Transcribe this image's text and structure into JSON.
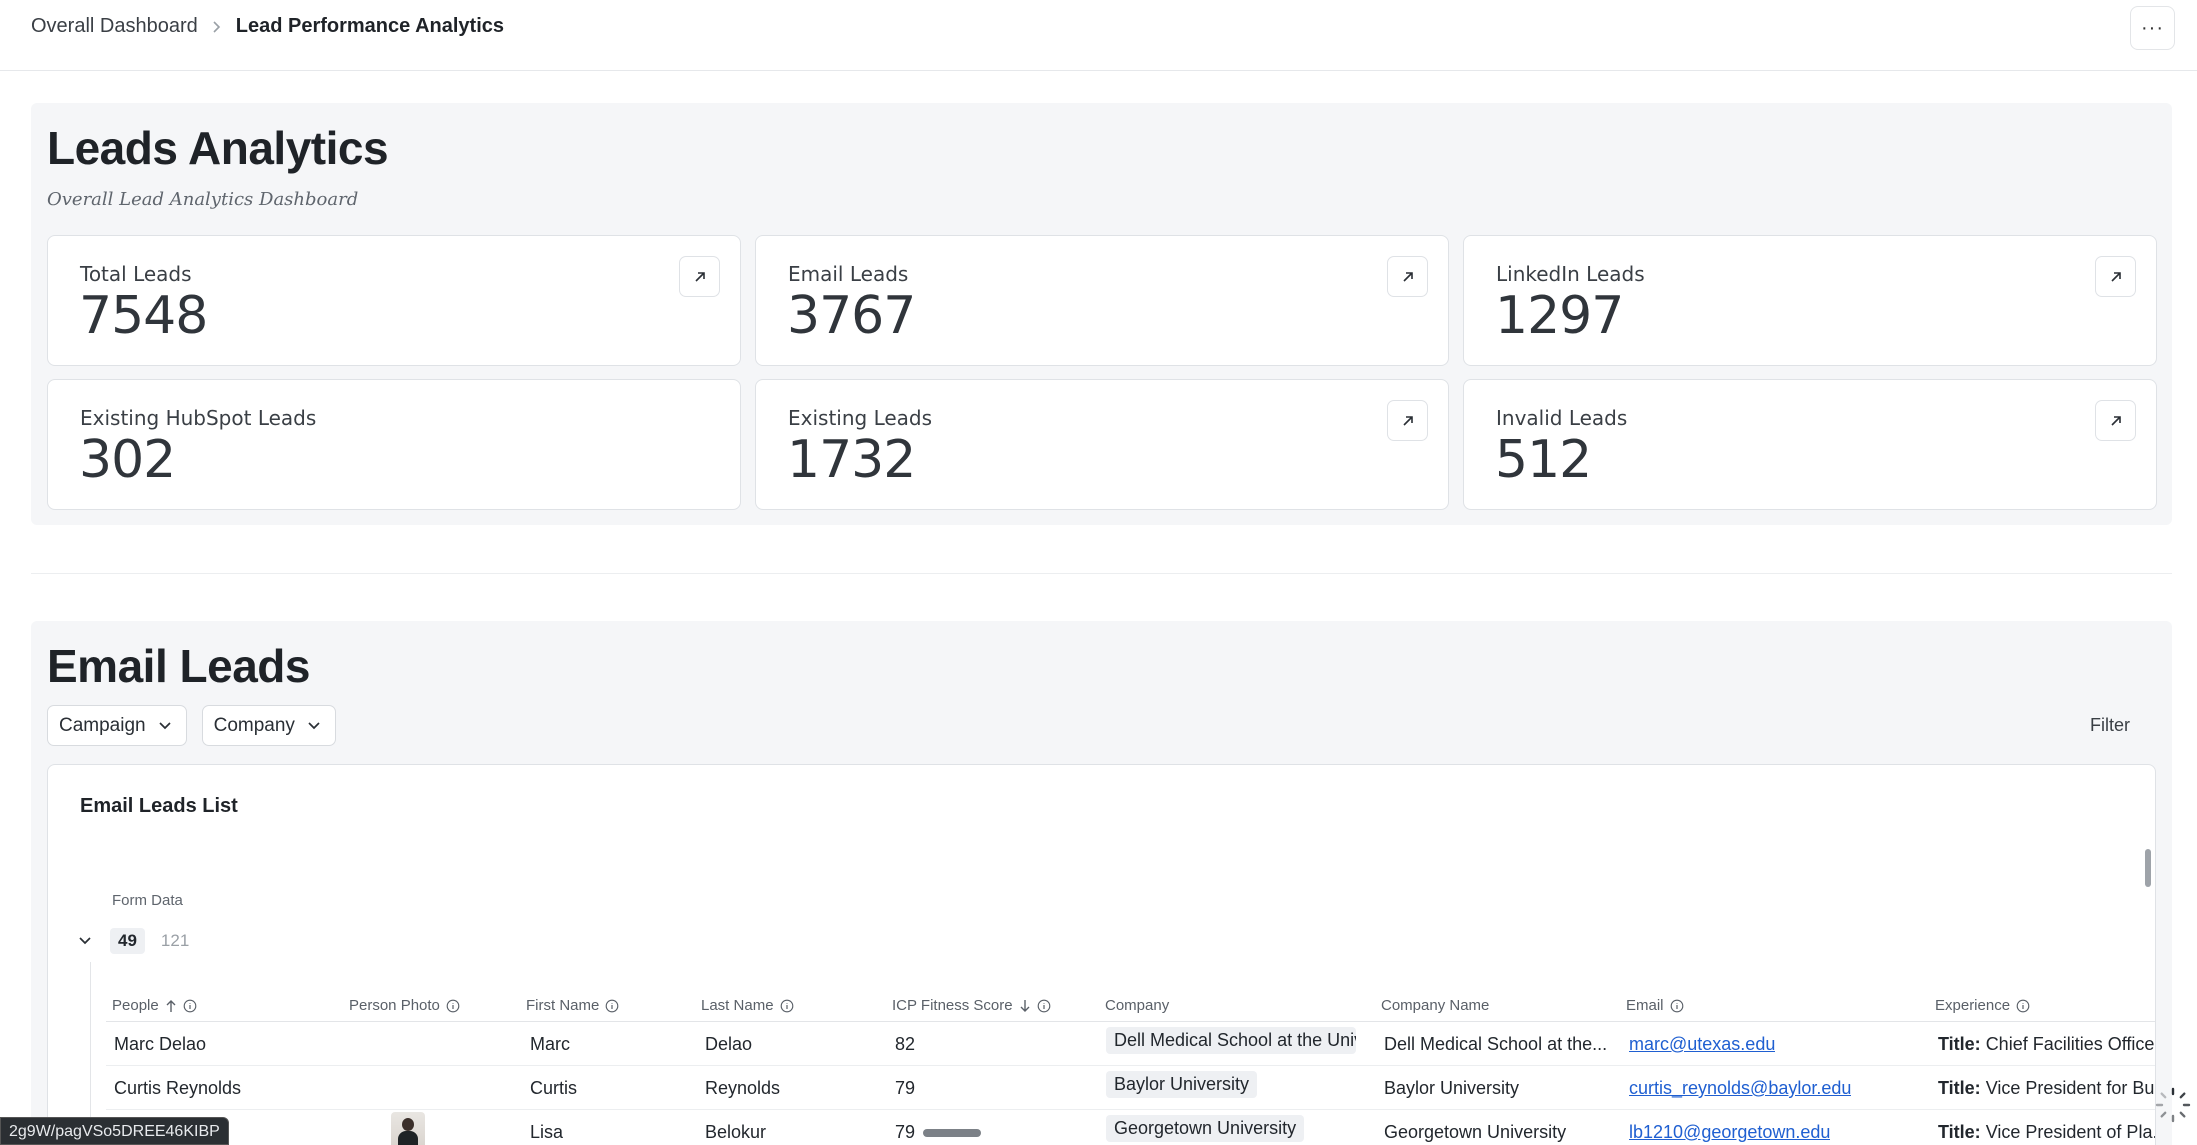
{
  "breadcrumb": {
    "parent": "Overall Dashboard",
    "current": "Lead Performance Analytics"
  },
  "header": {
    "more_label": "···"
  },
  "analytics": {
    "title": "Leads Analytics",
    "subtitle": "Overall Lead Analytics Dashboard",
    "cards": [
      {
        "label": "Total Leads",
        "value": "7548",
        "has_link": true
      },
      {
        "label": "Email Leads",
        "value": "3767",
        "has_link": true
      },
      {
        "label": "LinkedIn Leads",
        "value": "1297",
        "has_link": true
      },
      {
        "label": "Existing HubSpot Leads",
        "value": "302",
        "has_link": false
      },
      {
        "label": "Existing Leads",
        "value": "1732",
        "has_link": true
      },
      {
        "label": "Invalid Leads",
        "value": "512",
        "has_link": true
      }
    ]
  },
  "email_leads": {
    "title": "Email Leads",
    "filters": {
      "campaign": "Campaign",
      "company": "Company",
      "filter": "Filter"
    },
    "list": {
      "title": "Email Leads List",
      "group_label": "Form Data",
      "group_count": "49",
      "group_total": "121",
      "columns": {
        "people": "People",
        "photo": "Person Photo",
        "first_name": "First Name",
        "last_name": "Last Name",
        "icp": "ICP Fitness Score",
        "company": "Company",
        "company_name": "Company Name",
        "email": "Email",
        "experience": "Experience"
      },
      "rows": [
        {
          "people": "Marc Delao",
          "first_name": "Marc",
          "last_name": "Delao",
          "icp": "82",
          "company": "Dell Medical School at the Univ",
          "company_name": "Dell Medical School at the...",
          "email": "marc@utexas.edu",
          "exp_label": "Title:",
          "exp_value": "Chief Facilities Officer"
        },
        {
          "people": "Curtis Reynolds",
          "first_name": "Curtis",
          "last_name": "Reynolds",
          "icp": "79",
          "company": "Baylor University",
          "company_name": "Baylor University",
          "email": "curtis_reynolds@baylor.edu",
          "exp_label": "Title:",
          "exp_value": "Vice President for Bu..."
        },
        {
          "people": "",
          "first_name": "Lisa",
          "last_name": "Belokur",
          "icp": "79",
          "company": "Georgetown University",
          "company_name": "Georgetown University",
          "email": "lb1210@georgetown.edu",
          "exp_label": "Title:",
          "exp_value": "Vice President of Pla..."
        }
      ]
    }
  },
  "status_bar": {
    "url": "2g9W/pagVSo5DREE46KIBP"
  }
}
